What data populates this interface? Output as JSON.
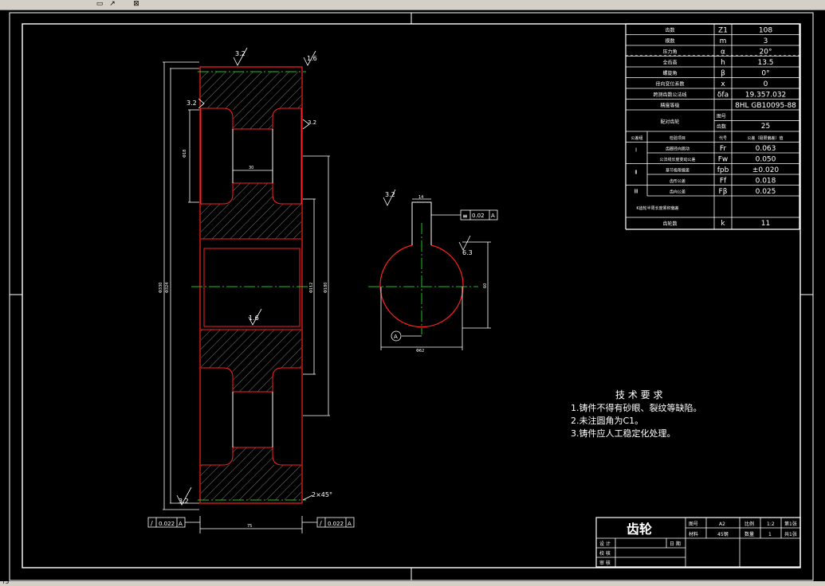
{
  "toolbar": {
    "item_1": "▭",
    "item_2": "↗",
    "item_3": "⊠",
    "status": "⊤J"
  },
  "params": {
    "rows": [
      {
        "label": "齿数",
        "sym": "Z1",
        "val": "108"
      },
      {
        "label": "模数",
        "sym": "m",
        "val": "3"
      },
      {
        "label": "压力角",
        "sym": "α",
        "val": "20°"
      },
      {
        "label": "全齿高",
        "sym": "h",
        "val": "13.5"
      },
      {
        "label": "螺旋角",
        "sym": "β",
        "val": "0°"
      },
      {
        "label": "径向变位系数",
        "sym": "x",
        "val": "0"
      },
      {
        "label": "跨测齿数公法线",
        "sym": "δfa",
        "val": "19.357.032"
      },
      {
        "label": "精度等级",
        "sym": "",
        "val": "8HL  GB10095-88"
      }
    ],
    "pair_label": "配对齿轮",
    "pair_sub": [
      "图号",
      "齿数"
    ],
    "pair_val": [
      "",
      "25"
    ],
    "group_label": "公差组",
    "check_head": [
      "检验项目",
      "代号",
      "公差（极限偏差）值"
    ],
    "groups": [
      "Ⅰ",
      "Ⅱ",
      "Ⅲ"
    ],
    "checks": [
      {
        "label": "齿圈径向跳动",
        "sym": "Fr",
        "val": "0.063"
      },
      {
        "label": "公法线长度变动公差",
        "sym": "Fw",
        "val": "0.050"
      },
      {
        "label": "基节极限偏差",
        "sym": "fpb",
        "val": "±0.020"
      },
      {
        "label": "齿形公差",
        "sym": "Ff",
        "val": "0.018"
      },
      {
        "label": "齿向公差",
        "sym": "Fβ",
        "val": "0.025"
      }
    ],
    "ring_label": "K齿轮半周长度累积偏差",
    "last": {
      "label": "齿轮数",
      "sym": "k",
      "val": "11"
    }
  },
  "tech": {
    "title": "技 术 要 求",
    "items": [
      "1.铸件不得有砂眼、裂纹等缺陷。",
      "2.未注圆角为C1。",
      "3.铸件应人工稳定化处理。"
    ]
  },
  "title_block": {
    "name": "齿轮",
    "r1": [
      "图号",
      "A2",
      "比例",
      "1:2",
      "第1张"
    ],
    "r2": [
      "材料",
      "45钢",
      "数量",
      "1",
      "共1张"
    ],
    "rows": [
      "设 计",
      "校 核",
      "审 核"
    ],
    "date": "日 期"
  },
  "annotations": {
    "rough_top": "3.2",
    "rough_right": "1.6",
    "rough_left": "3.2",
    "rough_web": "3.2",
    "rough_bore": "1.6",
    "rough_bl": "3.2",
    "chamfer": "2×45°",
    "dim_web_w": "30",
    "dim_hole": "Φ18",
    "dim_od": "Φ330",
    "dim_tip": "Φ324",
    "dim_hub": "Φ112",
    "dim_hub2": "Φ180",
    "dim_width": "75",
    "tol_left": [
      "/",
      "0.022",
      "A"
    ],
    "tol_right": [
      "/",
      "0.022",
      "A"
    ],
    "key_rough": "3.2",
    "key_width": "14",
    "key_tol": [
      "≡",
      "0.02",
      "A"
    ],
    "key_rough2": "6.3",
    "key_depth": "60",
    "bore_dia": "Φ62",
    "datum": "A"
  },
  "colors": {
    "frame": "#ffffff",
    "outline": "#ff2020",
    "hatch": "#c8c8c8",
    "center": "#20c020",
    "dim": "#ffffff"
  }
}
